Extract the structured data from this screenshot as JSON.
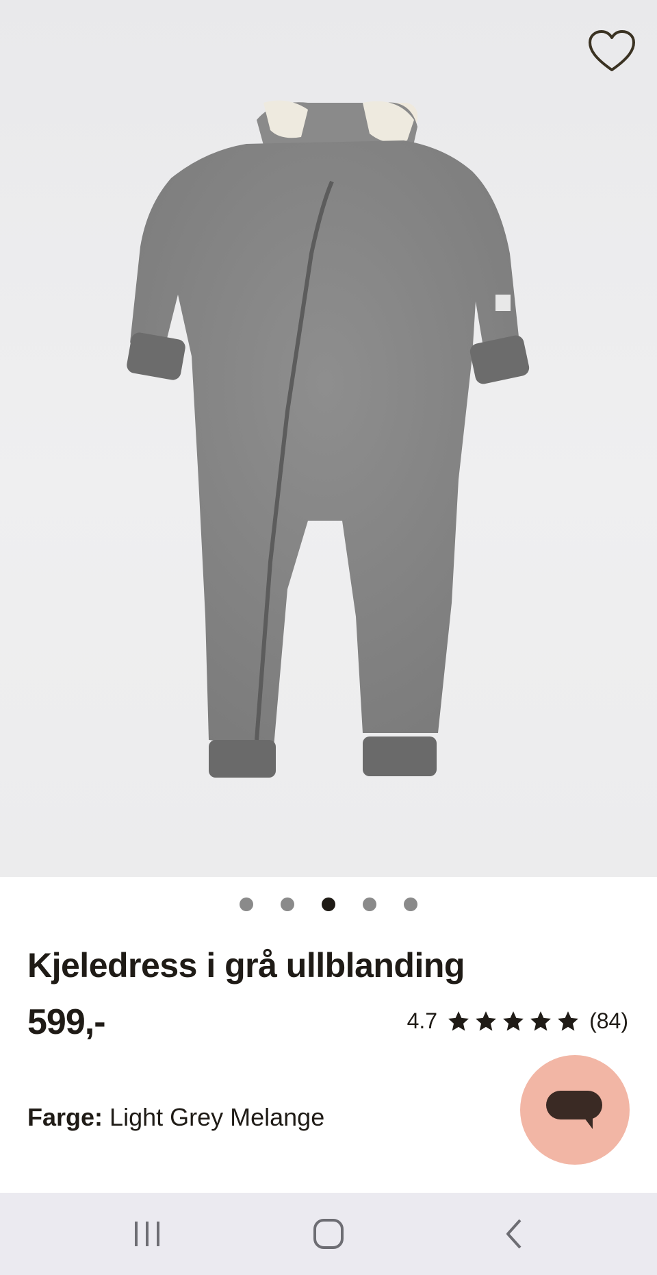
{
  "product": {
    "title": "Kjeledress i grå ullblanding",
    "price": "599,-",
    "rating_value": "4.7",
    "rating_stars": 5,
    "review_count": "(84)",
    "color_label": "Farge:",
    "color_value": "Light Grey Melange"
  },
  "gallery": {
    "image_count": 5,
    "active_index": 3
  },
  "icons": {
    "favorite": "heart-outline-icon",
    "chat": "chat-bubble-icon",
    "nav_recent": "recent-apps-icon",
    "nav_home": "home-icon",
    "nav_back": "back-chevron-icon"
  },
  "colors": {
    "text": "#1f1b16",
    "chat_button": "#f2b6a5",
    "dot_inactive": "#8a8a8a",
    "navbar": "#ebeaf0"
  }
}
